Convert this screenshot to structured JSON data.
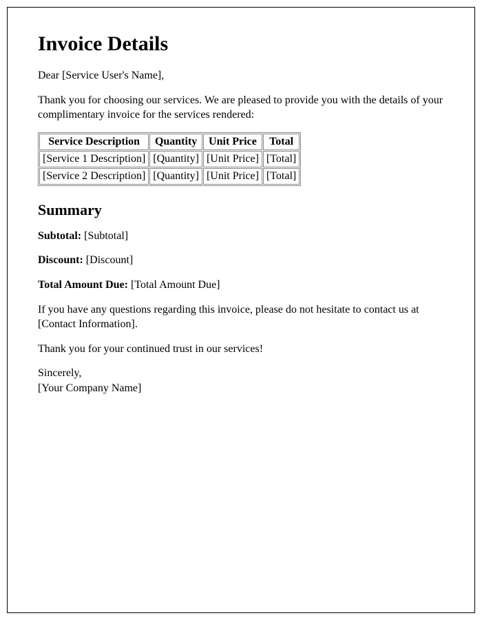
{
  "title": "Invoice Details",
  "salutation": "Dear [Service User's Name],",
  "intro": "Thank you for choosing our services. We are pleased to provide you with the details of your complimentary invoice for the services rendered:",
  "table": {
    "headers": [
      "Service Description",
      "Quantity",
      "Unit Price",
      "Total"
    ],
    "rows": [
      [
        "[Service 1 Description]",
        "[Quantity]",
        "[Unit Price]",
        "[Total]"
      ],
      [
        "[Service 2 Description]",
        "[Quantity]",
        "[Unit Price]",
        "[Total]"
      ]
    ]
  },
  "summary_heading": "Summary",
  "summary": {
    "subtotal_label": "Subtotal:",
    "subtotal_value": " [Subtotal]",
    "discount_label": "Discount:",
    "discount_value": " [Discount]",
    "total_due_label": "Total Amount Due:",
    "total_due_value": " [Total Amount Due]"
  },
  "contact_line": "If you have any questions regarding this invoice, please do not hesitate to contact us at [Contact Information].",
  "thanks_line": "Thank you for your continued trust in our services!",
  "signoff": "Sincerely,",
  "company": "[Your Company Name]"
}
